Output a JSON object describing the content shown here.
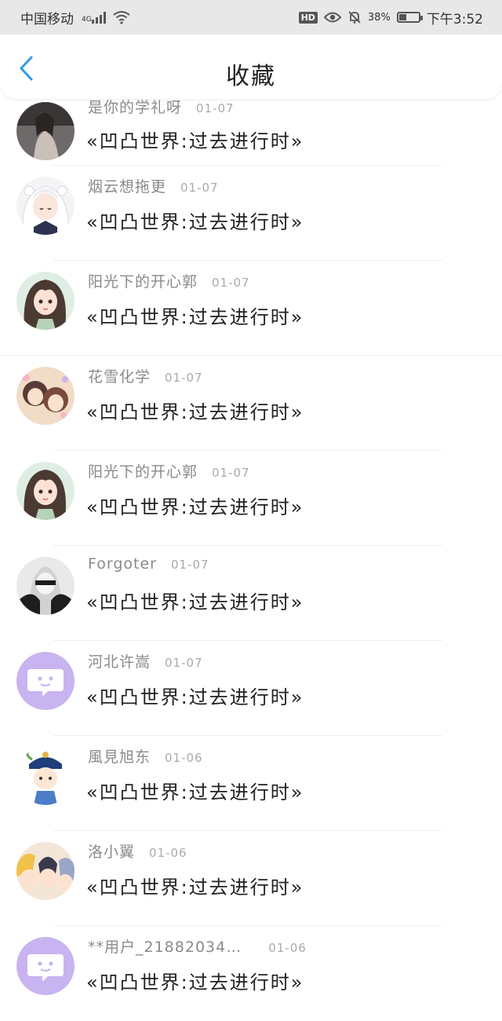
{
  "status_bar": {
    "carrier": "中国移动",
    "network": "4G",
    "hd": "HD",
    "battery_percent": "38%",
    "battery_level": 0.38,
    "time": "下午3:52"
  },
  "header": {
    "title": "收藏",
    "accent_color": "#2f9ae8"
  },
  "items": [
    {
      "username": "是你的学礼呀",
      "date": "01-07",
      "title": "«凹凸世界:过去进行时»",
      "avatar": "photo-avatar-girl-icon"
    },
    {
      "username": "烟云想拖更",
      "date": "01-07",
      "title": "«凹凸世界:过去进行时»",
      "avatar": "anime-white-hair-avatar-icon"
    },
    {
      "username": "阳光下的开心郭",
      "date": "01-07",
      "title": "«凹凸世界:过去进行时»",
      "avatar": "cartoon-girl-avatar-icon"
    },
    {
      "username": "花雪化学",
      "date": "01-07",
      "title": "«凹凸世界:过去进行时»",
      "avatar": "anime-couple-avatar-icon"
    },
    {
      "username": "阳光下的开心郭",
      "date": "01-07",
      "title": "«凹凸世界:过去进行时»",
      "avatar": "cartoon-girl-avatar-icon"
    },
    {
      "username": "Forgoter",
      "date": "01-07",
      "title": "«凹凸世界:过去进行时»",
      "avatar": "monochrome-anime-avatar-icon"
    },
    {
      "username": "河北许嵩",
      "date": "01-07",
      "title": "«凹凸世界:过去进行时»",
      "avatar": "default-chat-avatar-icon"
    },
    {
      "username": "風見旭东",
      "date": "01-06",
      "title": "«凹凸世界:过去进行时»",
      "avatar": "chibi-qing-avatar-icon"
    },
    {
      "username": "洛小翼",
      "date": "01-06",
      "title": "«凹凸世界:过去进行时»",
      "avatar": "anime-group-avatar-icon"
    },
    {
      "username": "**用户_21882034…",
      "date": "01-06",
      "title": "«凹凸世界:过去进行时»",
      "avatar": "default-chat-avatar-icon"
    }
  ]
}
